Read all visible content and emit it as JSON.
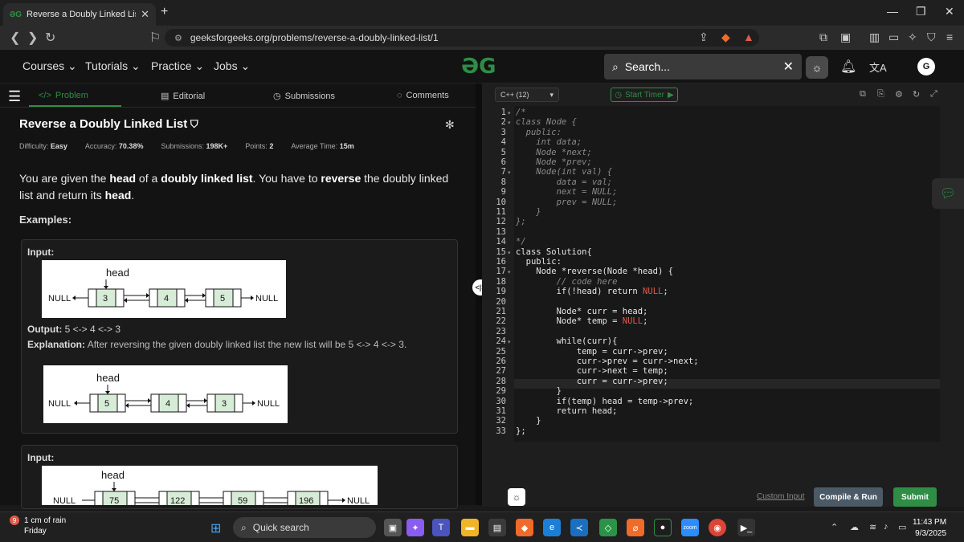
{
  "browser": {
    "tab_title": "Reverse a Doubly Linked List | Pr",
    "tab_favicon": "gfg",
    "url": "geeksforgeeks.org/problems/reverse-a-doubly-linked-list/1",
    "new_tab": "+",
    "close_tab": "✕"
  },
  "header": {
    "menus": [
      "Courses",
      "Tutorials",
      "Practice",
      "Jobs"
    ],
    "logo": "ƏG",
    "search_placeholder": "Search...",
    "avatar_letter": "G"
  },
  "left_tabs": {
    "problem": "Problem",
    "editorial": "Editorial",
    "submissions": "Submissions",
    "comments": "Comments"
  },
  "problem": {
    "title": "Reverse a Doubly Linked List",
    "meta": [
      {
        "label": "Difficulty:",
        "value": "Easy"
      },
      {
        "label": "Accuracy:",
        "value": "70.38%"
      },
      {
        "label": "Submissions:",
        "value": "198K+"
      },
      {
        "label": "Points:",
        "value": "2"
      },
      {
        "label": "Average Time:",
        "value": "15m"
      }
    ],
    "desc_parts": [
      "You are given the ",
      "head",
      " of a ",
      "doubly linked list",
      ". You have to ",
      "reverse",
      " the doubly linked list and return its ",
      "head",
      "."
    ],
    "examples_label": "Examples:",
    "example1": {
      "input_label": "Input:",
      "head_label": "head",
      "null_label": "NULL",
      "input_nodes": [
        "3",
        "4",
        "5"
      ],
      "output_label": "Output:",
      "output_value": "5 <-> 4 <-> 3",
      "explanation_label": "Explanation:",
      "explanation": "After reversing the given doubly linked list the new list will be 5 <-> 4 <-> 3.",
      "output_nodes": [
        "5",
        "4",
        "3"
      ]
    },
    "example2": {
      "input_label": "Input:",
      "head_label": "head",
      "null_label": "NULL",
      "input_nodes": [
        "75",
        "122",
        "59",
        "196"
      ]
    }
  },
  "editor": {
    "language": "C++ (12)",
    "timer_label": "Start Timer",
    "code_lines": [
      "/*",
      "class Node {",
      "  public:",
      "    int data;",
      "    Node *next;",
      "    Node *prev;",
      "    Node(int val) {",
      "        data = val;",
      "        next = NULL;",
      "        prev = NULL;",
      "    }",
      "};",
      "",
      "*/",
      "class Solution{",
      "  public:",
      "    Node *reverse(Node *head) {",
      "        // code here",
      "        if(!head) return NULL;",
      "",
      "        Node* curr = head;",
      "        Node* temp = NULL;",
      "",
      "        while(curr){",
      "            temp = curr->prev;",
      "            curr->prev = curr->next;",
      "            curr->next = temp;",
      "            curr = curr->prev;",
      "        }",
      "        if(temp) head = temp->prev;",
      "        return head;",
      "    }",
      "};"
    ],
    "custom_input": "Custom Input",
    "compile_run": "Compile & Run",
    "submit": "Submit"
  },
  "taskbar": {
    "weather_badge": "9",
    "weather_line1": "1 cm of rain",
    "weather_line2": "Friday",
    "search": "Quick search",
    "time": "11:43 PM",
    "date": "9/3/2025"
  }
}
